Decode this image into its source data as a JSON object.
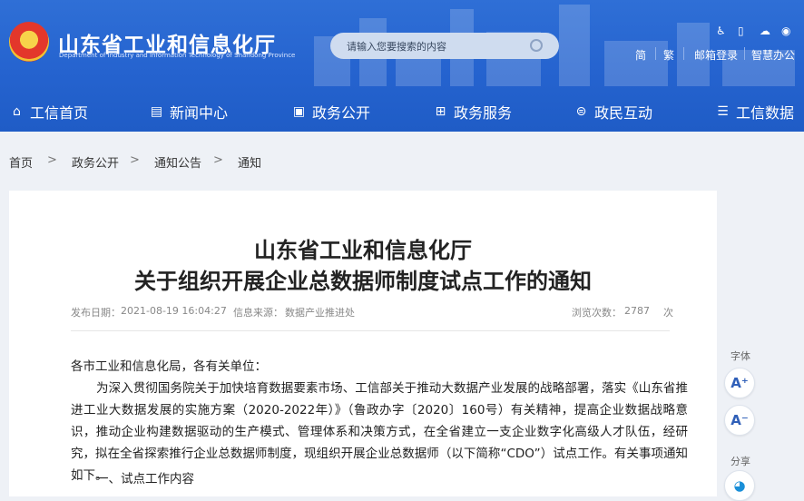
{
  "header": {
    "site_name": "山东省工业和信息化厅",
    "site_name_en": "Department of Industry and Information Technology of Shandong Province",
    "search_placeholder": "请输入您要搜索的内容",
    "links": {
      "simplified": "简",
      "traditional": "繁",
      "mail_login": "邮箱登录",
      "smart_office": "智慧办公"
    }
  },
  "nav": {
    "items": [
      {
        "label": "工信首页",
        "icon": "home-icon"
      },
      {
        "label": "新闻中心",
        "icon": "news-icon"
      },
      {
        "label": "政务公开",
        "icon": "monitor-icon"
      },
      {
        "label": "政务服务",
        "icon": "service-icon"
      },
      {
        "label": "政民互动",
        "icon": "chat-icon"
      },
      {
        "label": "工信数据",
        "icon": "database-icon"
      }
    ]
  },
  "breadcrumb": {
    "items": [
      "首页",
      "政务公开",
      "通知公告",
      "通知"
    ],
    "separator": ">"
  },
  "article": {
    "title_line1": "山东省工业和信息化厅",
    "title_line2": "关于组织开展企业总数据师制度试点工作的通知",
    "publish_label": "发布日期：",
    "publish_date": "2021-08-19 16:04:27",
    "source_label": "信息来源：",
    "source": "数据产业推进处",
    "views_label": "浏览次数：",
    "views": "2787",
    "views_unit": "次",
    "salutation": "各市工业和信息化局，各有关单位：",
    "paragraph": "为深入贯彻国务院关于加快培育数据要素市场、工信部关于推动大数据产业发展的战略部署，落实《山东省推进工业大数据发展的实施方案（2020-2022年）》（鲁政办字〔2020〕160号）有关精神，提高企业数据战略意识，推动企业构建数据驱动的生产模式、管理体系和决策方式，在全省建立一支企业数字化高级人才队伍，经研究，拟在全省探索推行企业总数据师制度，现组织开展企业总数据师（以下简称“CDO”）试点工作。有关事项通知如下。",
    "section1": "一、试点工作内容"
  },
  "sidebar": {
    "font_label": "字体",
    "font_increase": "A⁺",
    "font_decrease": "A⁻",
    "share_label": "分享"
  },
  "colors": {
    "header_blue": "#2563cf",
    "background": "#eef1f6",
    "accent": "#2f5fb8"
  }
}
